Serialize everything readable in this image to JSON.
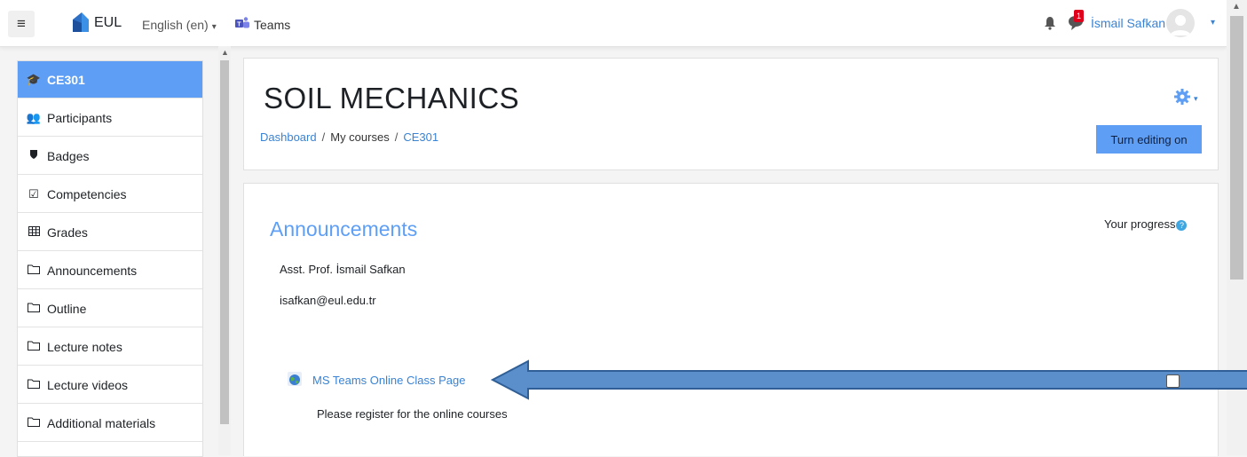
{
  "navbar": {
    "brand": "EUL",
    "language": "English (en)",
    "teams_link": "Teams",
    "notification_count": "1",
    "user_name": "İsmail Safkan"
  },
  "sidebar": {
    "items": [
      {
        "label": "CE301",
        "icon": "graduation-cap-icon",
        "active": true
      },
      {
        "label": "Participants",
        "icon": "users-icon"
      },
      {
        "label": "Badges",
        "icon": "shield-icon"
      },
      {
        "label": "Competencies",
        "icon": "check-square-icon"
      },
      {
        "label": "Grades",
        "icon": "table-icon"
      },
      {
        "label": "Announcements",
        "icon": "folder-icon"
      },
      {
        "label": "Outline",
        "icon": "folder-icon"
      },
      {
        "label": "Lecture notes",
        "icon": "folder-icon"
      },
      {
        "label": "Lecture videos",
        "icon": "folder-icon"
      },
      {
        "label": "Additional materials",
        "icon": "folder-icon"
      }
    ]
  },
  "header": {
    "course_title": "SOIL MECHANICS",
    "breadcrumb": [
      "Dashboard",
      "My courses",
      "CE301"
    ],
    "edit_button": "Turn editing on"
  },
  "main": {
    "section_title": "Announcements",
    "progress_label": "Your progress",
    "instructor": "Asst. Prof. İsmail Safkan",
    "email": "isafkan@eul.edu.tr",
    "activity_link": "MS Teams Online Class Page",
    "activity_description": "Please register for the online courses"
  },
  "colors": {
    "accent": "#5e9ff5",
    "link": "#3a83d3",
    "arrow_fill": "#5b8fcc",
    "arrow_stroke": "#2f5f96",
    "badge": "#e0001b"
  }
}
